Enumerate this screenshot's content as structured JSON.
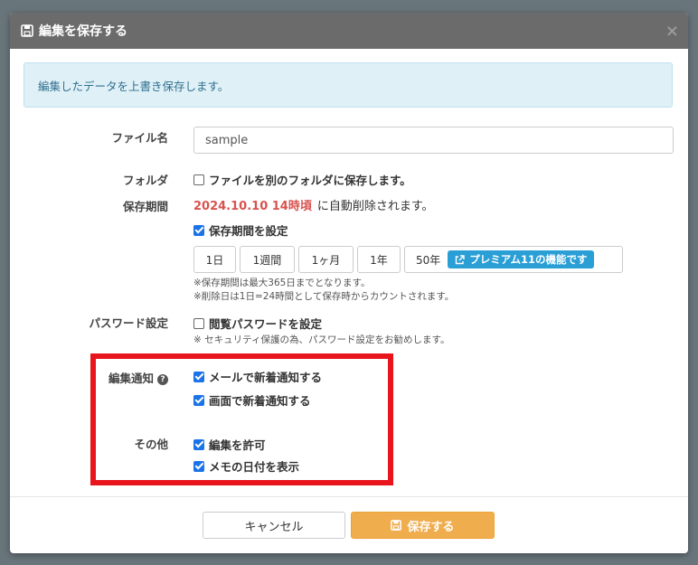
{
  "modal": {
    "title": "編集を保存する",
    "close_label": "×",
    "alert": "編集したデータを上書き保存します。"
  },
  "filename": {
    "label": "ファイル名",
    "value": "sample"
  },
  "folder": {
    "label": "フォルダ",
    "checkbox_label": "ファイルを別のフォルダに保存します。",
    "checked": false
  },
  "retention": {
    "label": "保存期間",
    "date": "2024.10.10 14時頃",
    "suffix": "に自動削除されます。",
    "set_label": "保存期間を設定",
    "set_checked": true,
    "buttons": [
      "1日",
      "1週間",
      "1ヶ月",
      "1年",
      "50年"
    ],
    "premium_badge": "プレミアム11の機能です",
    "note1": "※保存期間は最大365日までとなります。",
    "note2": "※削除日は1日=24時間として保存時からカウントされます。"
  },
  "password": {
    "label": "パスワード設定",
    "checkbox_label": "閲覧パスワードを設定",
    "checked": false,
    "note": "※ セキュリティ保護の為、パスワード設定をお勧めします。"
  },
  "notify": {
    "label": "編集通知",
    "help_icon": "?",
    "mail_label": "メールで新着通知する",
    "mail_checked": true,
    "screen_label": "画面で新着通知する",
    "screen_checked": true
  },
  "other": {
    "label": "その他",
    "edit_label": "編集を許可",
    "edit_checked": true,
    "memo_date_label": "メモの日付を表示",
    "memo_date_checked": true
  },
  "footer": {
    "cancel_label": "キャンセル",
    "save_label": "保存する"
  },
  "colors": {
    "highlight_box": "#e8161c",
    "save_button": "#f0ad4e",
    "premium_badge": "#2a9fd6",
    "retention_date": "#d9534f"
  },
  "icons": {
    "header": "floppy-disk-icon",
    "premium": "external-link-icon",
    "save": "floppy-disk-icon",
    "help": "question-circle-icon"
  }
}
